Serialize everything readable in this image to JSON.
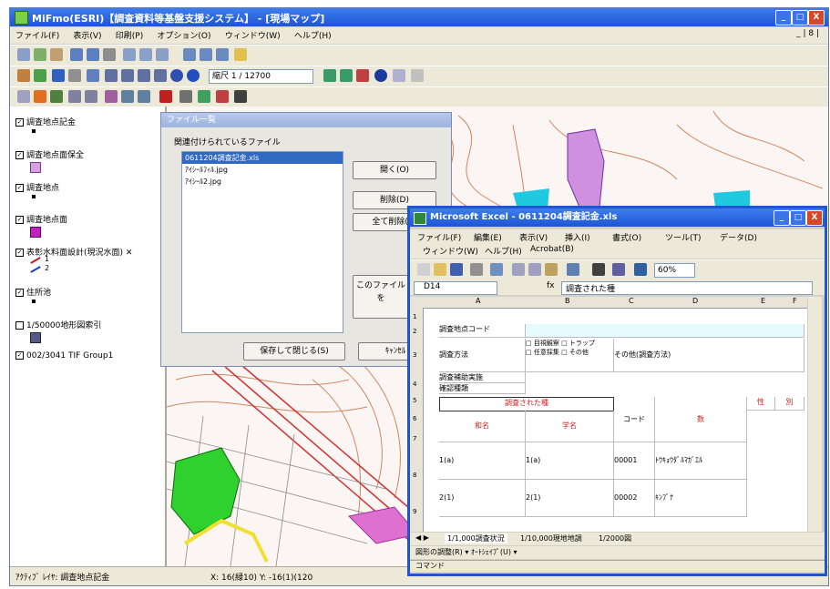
{
  "window": {
    "title": "MiFmo(ESRI)【調査資料等基盤支援システム】 - [現場マップ]",
    "min": "_",
    "max": "□",
    "close": "X"
  },
  "menu": [
    "ファイル(F)",
    "表示(V)",
    "印刷(P)",
    "オプション(O)",
    "ウィンドウ(W)",
    "ヘルプ(H)"
  ],
  "menu_right": "_ | 8 |",
  "toolbar": {
    "scale_label": "縮尺 1 / 12700"
  },
  "toc": {
    "items": [
      {
        "label": "調査地点記金",
        "checked": true
      },
      {
        "label": "調査地点面保全",
        "checked": true,
        "swatch": "#d8a0e0"
      },
      {
        "label": "調査地点",
        "checked": true
      },
      {
        "label": "調査地点面",
        "checked": true,
        "swatch": "#c020c0"
      },
      {
        "label": "表彰水料面設計(現況水面) ✕",
        "checked": true,
        "legend": [
          "1",
          "2"
        ]
      },
      {
        "label": "住所池",
        "checked": true
      },
      {
        "label": "1/50000地形図索引",
        "checked": false,
        "swatch": "#555a8a"
      },
      {
        "label": "002/3041 TIF Group1",
        "checked": true
      }
    ]
  },
  "status": {
    "left": "ｱｸﾃｨﾌﾞ ﾚｲﾔ: 調査地点記金",
    "coords": "X: 16(緑10) Y: -16(1)(120"
  },
  "dialog": {
    "title": "ファイル一覧",
    "heading": "関連付けられているファイル",
    "files": [
      "0611204調査記金.xls",
      "ｱｲｼｰﾙﾌｨﾙ.jpg",
      "ｱｲｼｰﾙ2.jpg"
    ],
    "btn_open": "開く(O)",
    "btn_delete": "削除(D)",
    "btn_delete_all": "全て削除(A)",
    "btn_file": "このファイルを",
    "btn_save_close": "保存して閉じる(S)",
    "btn_cancel": "ｷｬﾝｾﾙ"
  },
  "excel": {
    "title": "Microsoft Excel - 0611204調査記金.xls",
    "menu1": [
      "ファイル(F)",
      "編集(E)",
      "表示(V)",
      "挿入(I)",
      "書式(O)",
      "ツール(T)",
      "データ(D)"
    ],
    "menu2": [
      "ウィンドウ(W)",
      "ヘルプ(H)",
      "Acrobat(B)"
    ],
    "namebox": "D14",
    "formula": "調査された種",
    "zoom": "60%",
    "cols": [
      "A",
      "B",
      "C",
      "D",
      "E",
      "F"
    ],
    "rows": [
      "1",
      "2",
      "3",
      "4",
      "5",
      "6",
      "7",
      "8",
      "9"
    ],
    "cells": {
      "point_code": "調査地点コード",
      "method": "調査方法",
      "method_detail": "□ 目視観察 □ トラップ\n□ 任意採集 □ その他",
      "method_note": "その他(調査方法)",
      "note2": "調査補助実施",
      "note3": "確認種類",
      "species_header": "調査された種",
      "col_name1": "和名",
      "col_name2": "学名",
      "col_code": "コード",
      "col_count": "数",
      "row1_a": "1(a)",
      "row1_b": "1(a)",
      "row1_code": "00001",
      "row1_name": "ﾄｳｷｮｳﾀﾞﾙﾏｶﾞｴﾙ",
      "row2_a": "2(1)",
      "row2_b": "2(1)",
      "row2_code": "00002",
      "row2_name": "ｷﾝﾌﾞﾅ",
      "col_f1": "性",
      "col_f2": "別"
    },
    "sheet_tabs": [
      "1/1,000調査状況",
      "1/10,000現地地調",
      "1/2000図"
    ],
    "draw_toolbar": "図形の調整(R) ▾ ｵｰﾄｼｪｲﾌﾟ(U) ▾",
    "status": "コマンド"
  }
}
